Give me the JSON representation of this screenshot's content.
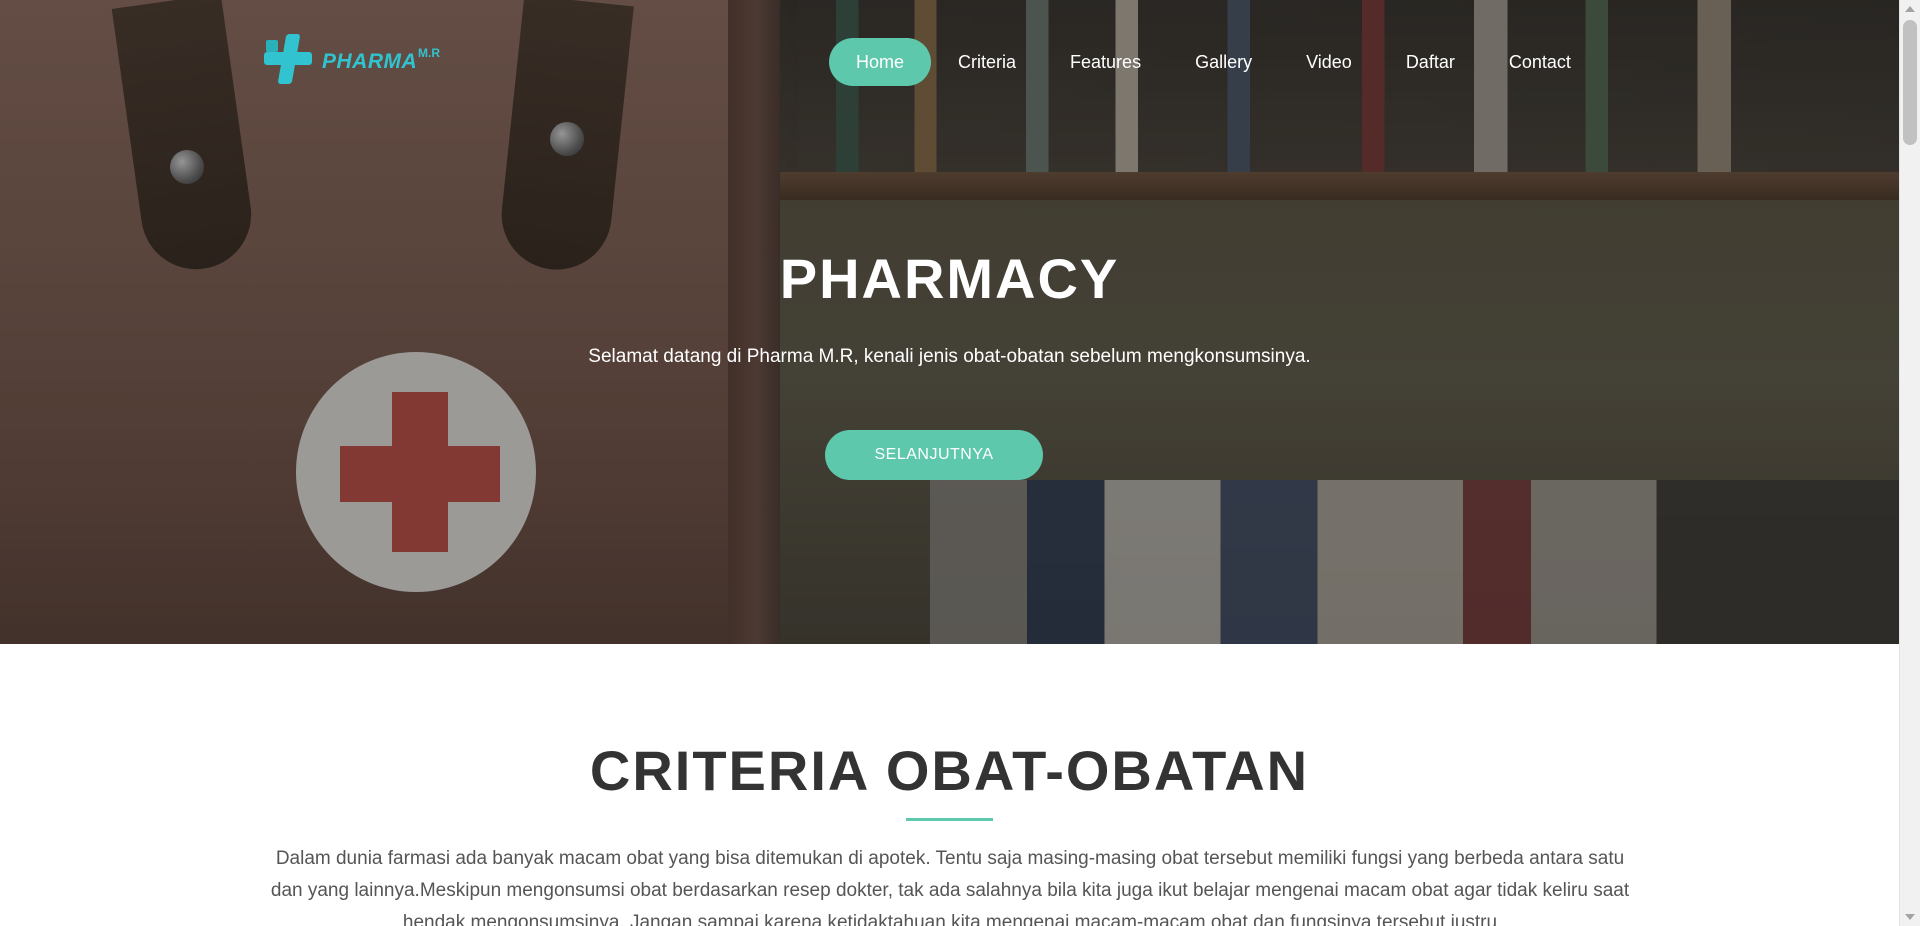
{
  "brand": {
    "logo_word": "PHARMA",
    "logo_suffix": "M.R"
  },
  "nav": {
    "items": [
      {
        "label": "Home",
        "active": true
      },
      {
        "label": "Criteria",
        "active": false
      },
      {
        "label": "Features",
        "active": false
      },
      {
        "label": "Gallery",
        "active": false
      },
      {
        "label": "Video",
        "active": false
      },
      {
        "label": "Daftar",
        "active": false
      },
      {
        "label": "Contact",
        "active": false
      }
    ]
  },
  "hero": {
    "title": "PHARMACY",
    "subtitle": "Selamat datang di Pharma M.R, kenali jenis obat-obatan sebelum mengkonsumsinya.",
    "cta_label": "SELANJUTNYA"
  },
  "criteria": {
    "title": "CRITERIA OBAT-OBATAN",
    "body": "Dalam dunia farmasi ada banyak macam obat yang bisa ditemukan di apotek. Tentu saja masing-masing obat tersebut memiliki fungsi yang berbeda antara satu dan yang lainnya.Meskipun mengonsumsi obat berdasarkan resep dokter, tak ada salahnya bila kita juga ikut belajar mengenai macam obat agar tidak keliru saat hendak mengonsumsinya. Jangan sampai karena ketidaktahuan kita mengenai macam-macam obat dan fungsinya tersebut justru"
  },
  "colors": {
    "accent": "#5ec8ad",
    "logo": "#31c3cf",
    "heading": "#333333"
  },
  "icons": {
    "logo_mark": "medical-cross-logo-icon"
  }
}
